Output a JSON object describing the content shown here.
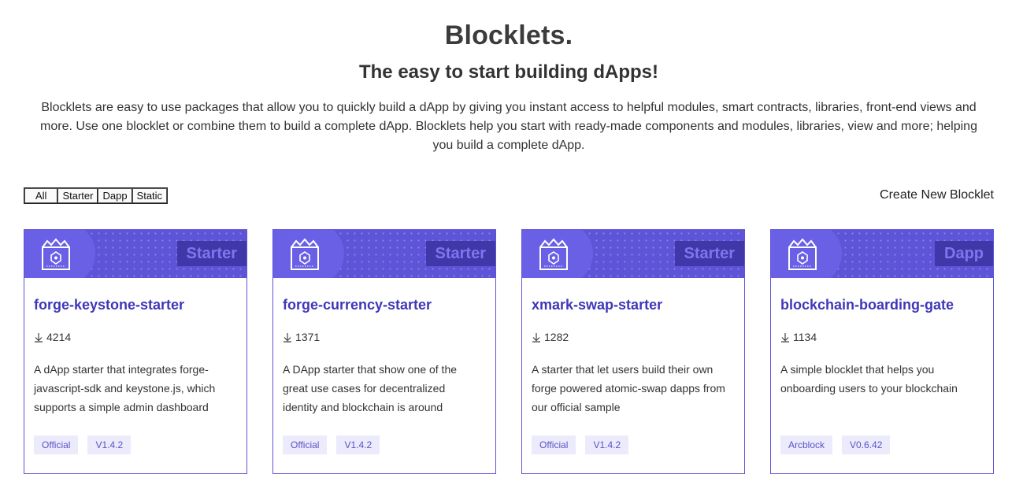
{
  "header": {
    "title": "Blocklets.",
    "subtitle": "The easy to start building dApps!",
    "description": "Blocklets are easy to use packages that allow you to quickly build a dApp by giving you instant access to helpful modules, smart contracts, libraries, front-end views and more. Use one blocklet or combine them to build a complete dApp. Blocklets help you start with ready-made components and modules, libraries, view and more; helping you build a complete dApp."
  },
  "filters": [
    "All",
    "Starter",
    "Dapp",
    "Static"
  ],
  "create_label": "Create New Blocklet",
  "colors": {
    "accent": "#5e54d8",
    "title": "#3f37b8",
    "badge_bg": "#ecebfb"
  },
  "cards": [
    {
      "type": "Starter",
      "name": "forge-keystone-starter",
      "downloads": "4214",
      "description": "A dApp starter that integrates forge-javascript-sdk and keystone.js, which supports a simple admin dashboard",
      "badges": [
        "Official",
        "V1.4.2"
      ]
    },
    {
      "type": "Starter",
      "name": "forge-currency-starter",
      "downloads": "1371",
      "description": "A DApp starter that show one of the great use cases for decentralized identity and blockchain is around",
      "badges": [
        "Official",
        "V1.4.2"
      ]
    },
    {
      "type": "Starter",
      "name": "xmark-swap-starter",
      "downloads": "1282",
      "description": "A starter that let users build their own forge powered atomic-swap dapps from our official sample",
      "badges": [
        "Official",
        "V1.4.2"
      ]
    },
    {
      "type": "Dapp",
      "name": "blockchain-boarding-gate",
      "downloads": "1134",
      "description": "A simple blocklet that helps you onboarding users to your blockchain",
      "badges": [
        "Arcblock",
        "V0.6.42"
      ]
    }
  ]
}
